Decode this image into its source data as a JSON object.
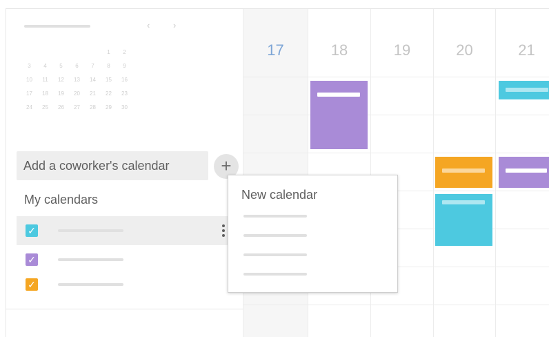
{
  "mini_calendar": {
    "prev_icon": "chevron-left-icon",
    "next_icon": "chevron-right-icon",
    "rows": [
      [
        "",
        "",
        "",
        "",
        "",
        "1",
        "2"
      ],
      [
        "3",
        "4",
        "5",
        "6",
        "7",
        "8",
        "9"
      ],
      [
        "10",
        "11",
        "12",
        "13",
        "14",
        "15",
        "16"
      ],
      [
        "17",
        "18",
        "19",
        "20",
        "21",
        "22",
        "23"
      ],
      [
        "24",
        "25",
        "26",
        "27",
        "28",
        "29",
        "30"
      ]
    ]
  },
  "sidebar": {
    "add_coworker_label": "Add a coworker's calendar",
    "add_icon": "plus-icon",
    "my_calendars_title": "My calendars",
    "calendars": [
      {
        "color": "#4dc9e0",
        "checked": true
      },
      {
        "color": "#a98bd7",
        "checked": true
      },
      {
        "color": "#f5a623",
        "checked": true
      }
    ]
  },
  "week": {
    "days": [
      "17",
      "18",
      "19",
      "20",
      "21"
    ],
    "today": "17",
    "today_color": "#7ea6d6"
  },
  "events": [
    {
      "day": "18",
      "color": "#a98bd7"
    },
    {
      "day": "21",
      "color": "#4dc9e0"
    },
    {
      "day": "20",
      "color": "#f5a623"
    },
    {
      "day": "21",
      "color": "#a98bd7"
    },
    {
      "day": "20",
      "color": "#4dc9e0"
    }
  ],
  "popup": {
    "title": "New calendar"
  }
}
